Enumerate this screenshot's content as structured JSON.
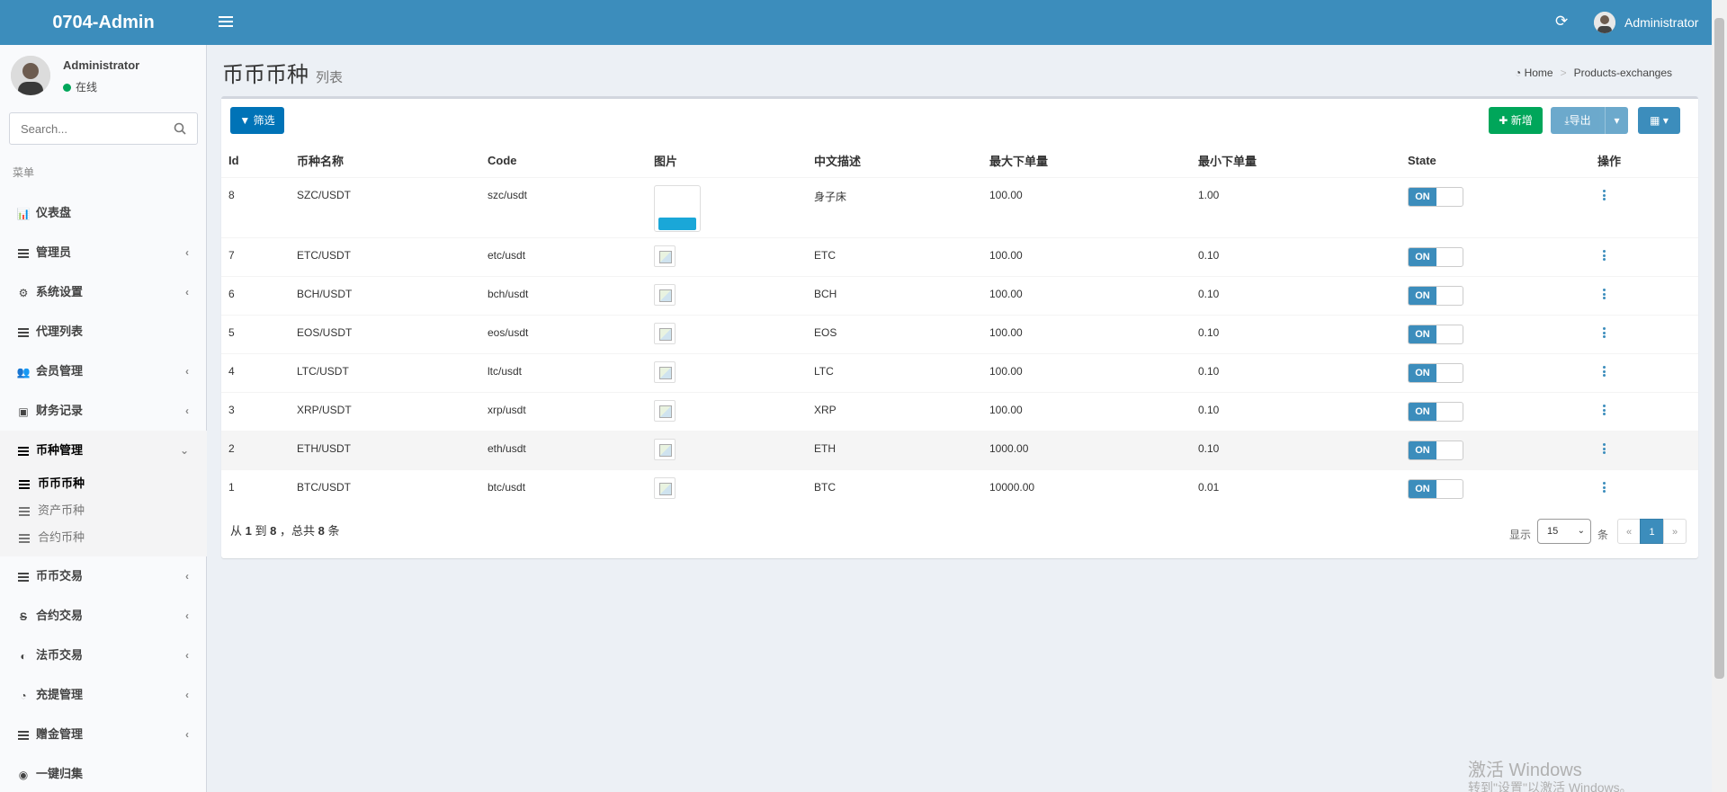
{
  "header": {
    "logo": "0704-Admin",
    "user": "Administrator"
  },
  "sidebar": {
    "user_name": "Administrator",
    "user_status": "在线",
    "search_placeholder": "Search...",
    "menu_header": "菜单",
    "items": [
      {
        "label": "仪表盘",
        "icon": "bar-chart-icon",
        "chevron": ""
      },
      {
        "label": "管理员",
        "icon": "server-icon",
        "chevron": "‹"
      },
      {
        "label": "系统设置",
        "icon": "sliders-icon",
        "chevron": "‹"
      },
      {
        "label": "代理列表",
        "icon": "list-icon",
        "chevron": ""
      },
      {
        "label": "会员管理",
        "icon": "users-icon",
        "chevron": "‹"
      },
      {
        "label": "财务记录",
        "icon": "money-icon",
        "chevron": "‹"
      },
      {
        "label": "币种管理",
        "icon": "list-icon",
        "chevron": "⌄"
      }
    ],
    "sub_items": [
      {
        "label": "币币币种"
      },
      {
        "label": "资产币种"
      },
      {
        "label": "合约币种"
      }
    ],
    "items_after": [
      {
        "label": "币币交易",
        "icon": "list-icon",
        "chevron": "‹"
      },
      {
        "label": "合约交易",
        "icon": "strikethrough-icon",
        "chevron": "‹"
      },
      {
        "label": "法币交易",
        "icon": "adjust-icon",
        "chevron": "‹"
      },
      {
        "label": "充提管理",
        "icon": "dashboard-icon",
        "chevron": "‹"
      },
      {
        "label": "赠金管理",
        "icon": "list-icon",
        "chevron": "‹"
      },
      {
        "label": "一键归集",
        "icon": "circle-dot-icon",
        "chevron": ""
      }
    ]
  },
  "page": {
    "title": "币币币种",
    "subtitle": "列表",
    "breadcrumb": [
      "Home",
      "Products-exchanges"
    ]
  },
  "toolbar": {
    "filter": "筛选",
    "add": "新增",
    "export": "导出"
  },
  "table": {
    "columns": [
      "Id",
      "币种名称",
      "Code",
      "图片",
      "中文描述",
      "最大下单量",
      "最小下单量",
      "State",
      "操作"
    ],
    "rows": [
      {
        "id": "8",
        "name": "SZC/USDT",
        "code": "szc/usdt",
        "desc": "身子床",
        "max": "100.00",
        "min": "1.00",
        "state": "ON"
      },
      {
        "id": "7",
        "name": "ETC/USDT",
        "code": "etc/usdt",
        "desc": "ETC",
        "max": "100.00",
        "min": "0.10",
        "state": "ON"
      },
      {
        "id": "6",
        "name": "BCH/USDT",
        "code": "bch/usdt",
        "desc": "BCH",
        "max": "100.00",
        "min": "0.10",
        "state": "ON"
      },
      {
        "id": "5",
        "name": "EOS/USDT",
        "code": "eos/usdt",
        "desc": "EOS",
        "max": "100.00",
        "min": "0.10",
        "state": "ON"
      },
      {
        "id": "4",
        "name": "LTC/USDT",
        "code": "ltc/usdt",
        "desc": "LTC",
        "max": "100.00",
        "min": "0.10",
        "state": "ON"
      },
      {
        "id": "3",
        "name": "XRP/USDT",
        "code": "xrp/usdt",
        "desc": "XRP",
        "max": "100.00",
        "min": "0.10",
        "state": "ON"
      },
      {
        "id": "2",
        "name": "ETH/USDT",
        "code": "eth/usdt",
        "desc": "ETH",
        "max": "1000.00",
        "min": "0.10",
        "state": "ON"
      },
      {
        "id": "1",
        "name": "BTC/USDT",
        "code": "btc/usdt",
        "desc": "BTC",
        "max": "10000.00",
        "min": "0.01",
        "state": "ON"
      }
    ]
  },
  "footer": {
    "summary_prefix": "从",
    "summary_from": "1",
    "summary_to_word": "到",
    "summary_to": "8",
    "summary_total_word": "，总共",
    "summary_total": "8",
    "summary_suffix": "条",
    "show_label": "显示",
    "page_size": "15",
    "rows_label": "条",
    "prev": "«",
    "current_page": "1",
    "next": "»"
  },
  "watermark": {
    "line1": "激活 Windows",
    "line2": "转到\"设置\"以激活 Windows。"
  },
  "colors": {
    "header": "#3c8dbc",
    "add_button": "#00a65a",
    "filter_button": "#0073b7",
    "toggle_on": "#3c8dbc",
    "online": "#00a65a"
  }
}
